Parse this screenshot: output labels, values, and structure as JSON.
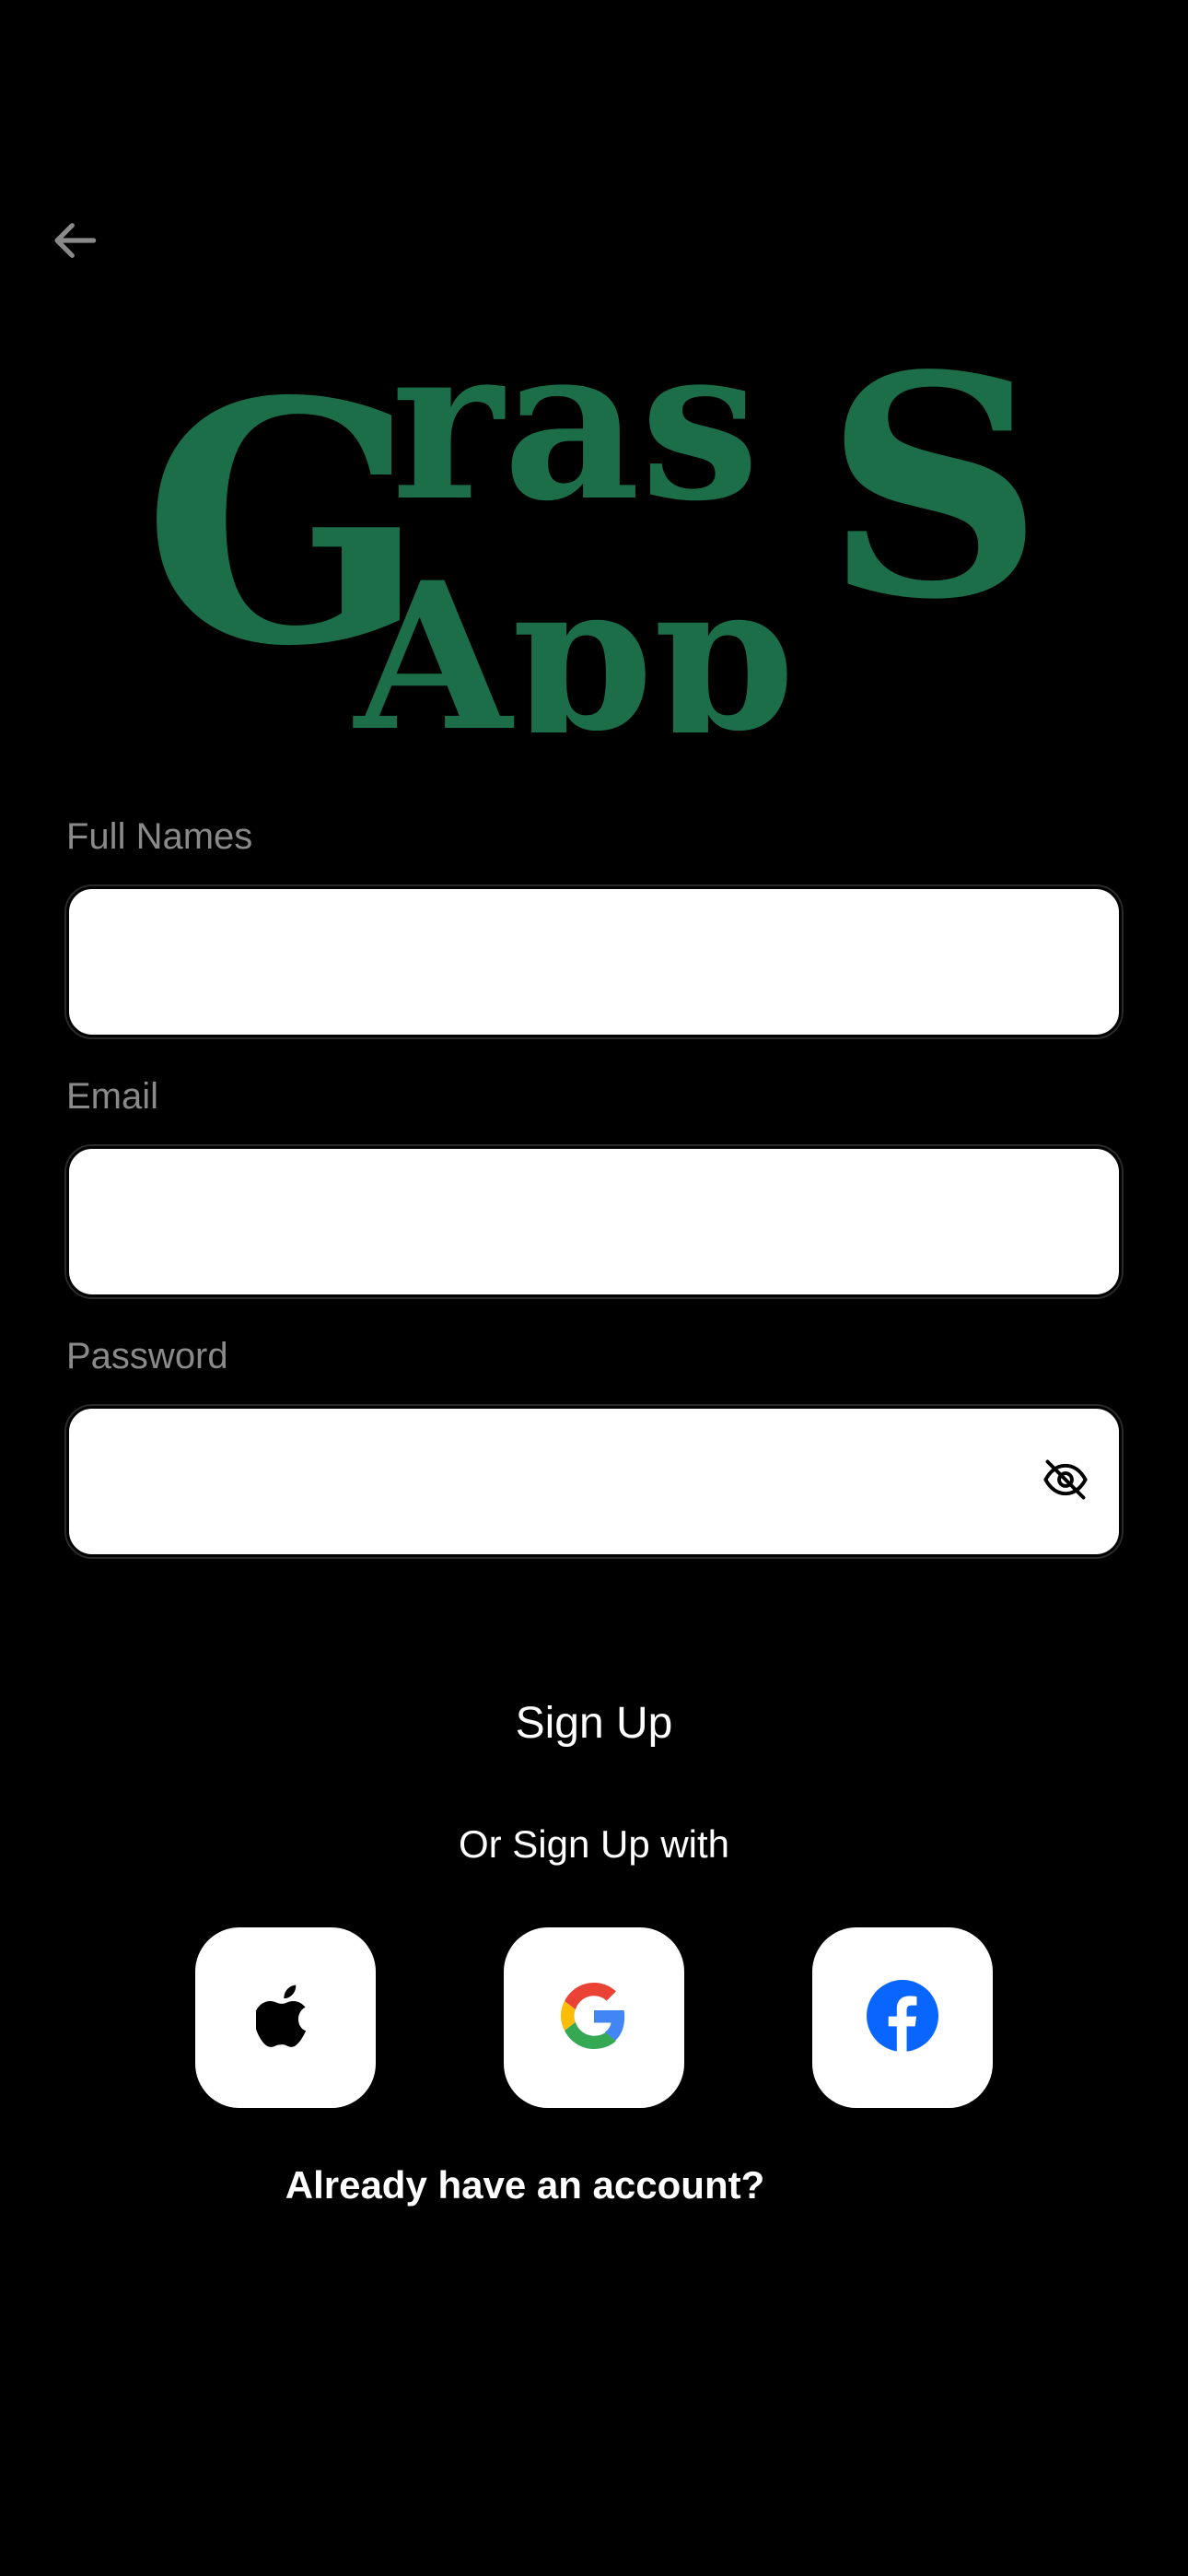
{
  "header": {
    "back_icon": "arrow-left-icon"
  },
  "logo": {
    "line1": "Grass",
    "line2": "App",
    "color": "#1c6e48"
  },
  "form": {
    "full_names": {
      "label": "Full Names",
      "value": "",
      "placeholder": ""
    },
    "email": {
      "label": "Email",
      "value": "",
      "placeholder": ""
    },
    "password": {
      "label": "Password",
      "value": "",
      "placeholder": "",
      "toggle_icon": "eye-off-icon"
    }
  },
  "actions": {
    "signup_label": "Sign Up",
    "or_label": "Or Sign Up with",
    "social": [
      {
        "name": "Apple",
        "icon": "apple-icon"
      },
      {
        "name": "Google",
        "icon": "google-icon"
      },
      {
        "name": "Facebook",
        "icon": "facebook-icon",
        "color": "#0866ff"
      }
    ],
    "login_prompt": "Already have an account?"
  },
  "colors": {
    "background": "#000000",
    "label": "#8a8a8a",
    "brand_green": "#1c6e48"
  }
}
